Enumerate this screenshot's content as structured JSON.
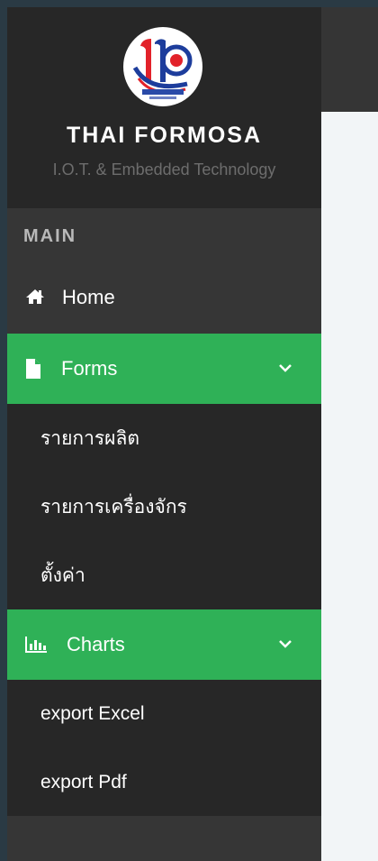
{
  "brand": {
    "title": "THAI FORMOSA",
    "subtitle": "I.O.T. & Embedded Technology"
  },
  "section": {
    "main": "MAIN"
  },
  "nav": {
    "home": "Home",
    "forms": "Forms",
    "forms_items": [
      "รายการผลิต",
      "รายการเครื่องจักร",
      "ตั้งค่า"
    ],
    "charts": "Charts",
    "charts_items": [
      "export Excel",
      "export Pdf"
    ]
  },
  "colors": {
    "accent": "#2fb157",
    "sidebar": "#363636",
    "sidebar_dark": "#272727"
  },
  "icons": {
    "home": "home-icon",
    "forms": "file-icon",
    "charts": "bar-chart-icon",
    "expand": "chevron-down-icon"
  }
}
